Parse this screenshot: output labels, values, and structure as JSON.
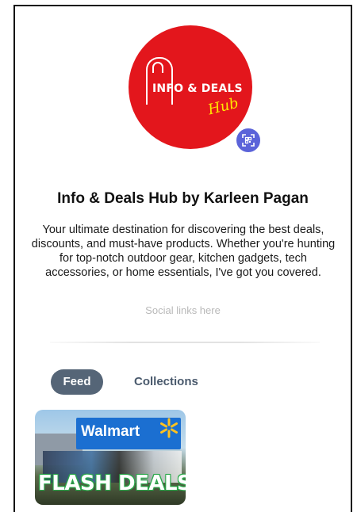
{
  "profile": {
    "logo": {
      "main_text": "INFO & DEALS",
      "script_text": "Hub"
    },
    "qr_icon": "qr-scan-icon",
    "name": "Info & Deals Hub by Karleen Pagan",
    "bio": "Your ultimate destination for discovering the best deals, discounts, and must-have products. Whether you're hunting for top-notch outdoor gear, kitchen gadgets, tech accessories, or home essentials, I've got you covered.",
    "social_placeholder": "Social links here"
  },
  "tabs": [
    {
      "label": "Feed",
      "active": true
    },
    {
      "label": "Collections",
      "active": false
    }
  ],
  "feed": {
    "cards": [
      {
        "brand_text": "Walmart",
        "headline": "FLASH DEALS"
      }
    ]
  },
  "colors": {
    "avatar_red": "#e3161c",
    "logo_yellow": "#ffe600",
    "qr_button": "#5b63d9",
    "tab_active_bg": "#556577",
    "tab_inactive_text": "#4a5a6d",
    "social_text": "#b9b9b9",
    "walmart_blue": "#1b6fd1",
    "flash_green": "#2aa94a"
  }
}
